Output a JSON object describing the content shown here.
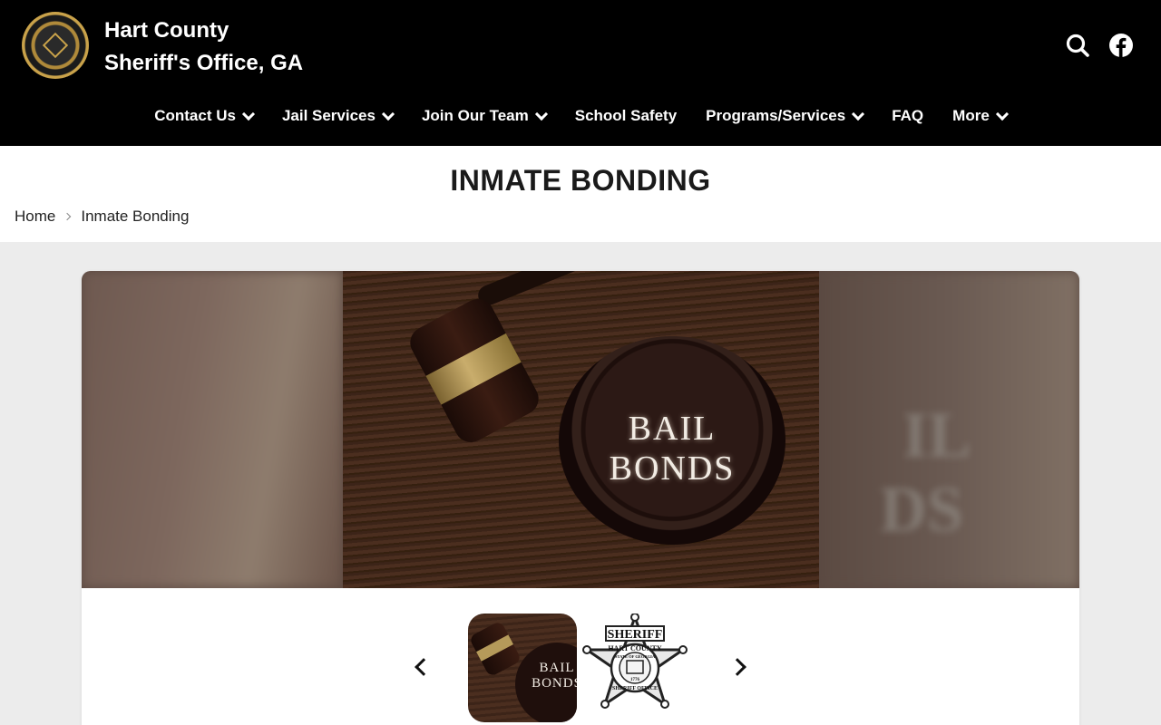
{
  "site": {
    "title_line1": "Hart County",
    "title_line2": "Sheriff's Office, GA"
  },
  "header_icons": {
    "search": "search-icon",
    "facebook": "facebook-icon"
  },
  "nav": {
    "items": [
      {
        "label": "Contact Us",
        "has_dropdown": true
      },
      {
        "label": "Jail Services",
        "has_dropdown": true
      },
      {
        "label": "Join Our Team",
        "has_dropdown": true
      },
      {
        "label": "School Safety",
        "has_dropdown": false
      },
      {
        "label": "Programs/Services",
        "has_dropdown": true
      },
      {
        "label": "FAQ",
        "has_dropdown": false
      },
      {
        "label": "More",
        "has_dropdown": true
      }
    ]
  },
  "page": {
    "title": "INMATE BONDING"
  },
  "breadcrumb": {
    "home": "Home",
    "current": "Inmate Bonding"
  },
  "hero": {
    "image_text_line1": "BAIL",
    "image_text_line2": "BONDS",
    "blur_text_line1": "IL",
    "blur_text_line2": "DS"
  },
  "thumbnails": {
    "items": [
      {
        "alt": "bail-bonds-thumbnail",
        "text_line1": "BAIL",
        "text_line2": "BONDS"
      },
      {
        "alt": "sheriff-badge-thumbnail",
        "text_top": "SHERIFF",
        "text_ring": "HART COUNTY",
        "text_bottom": "SHERIFF OFFICE",
        "text_center": "STATE OF GEORGIA",
        "year": "1776"
      }
    ]
  },
  "colors": {
    "header_bg": "#000000",
    "page_bg": "#ececec",
    "accent_gold": "#c9a24a"
  }
}
